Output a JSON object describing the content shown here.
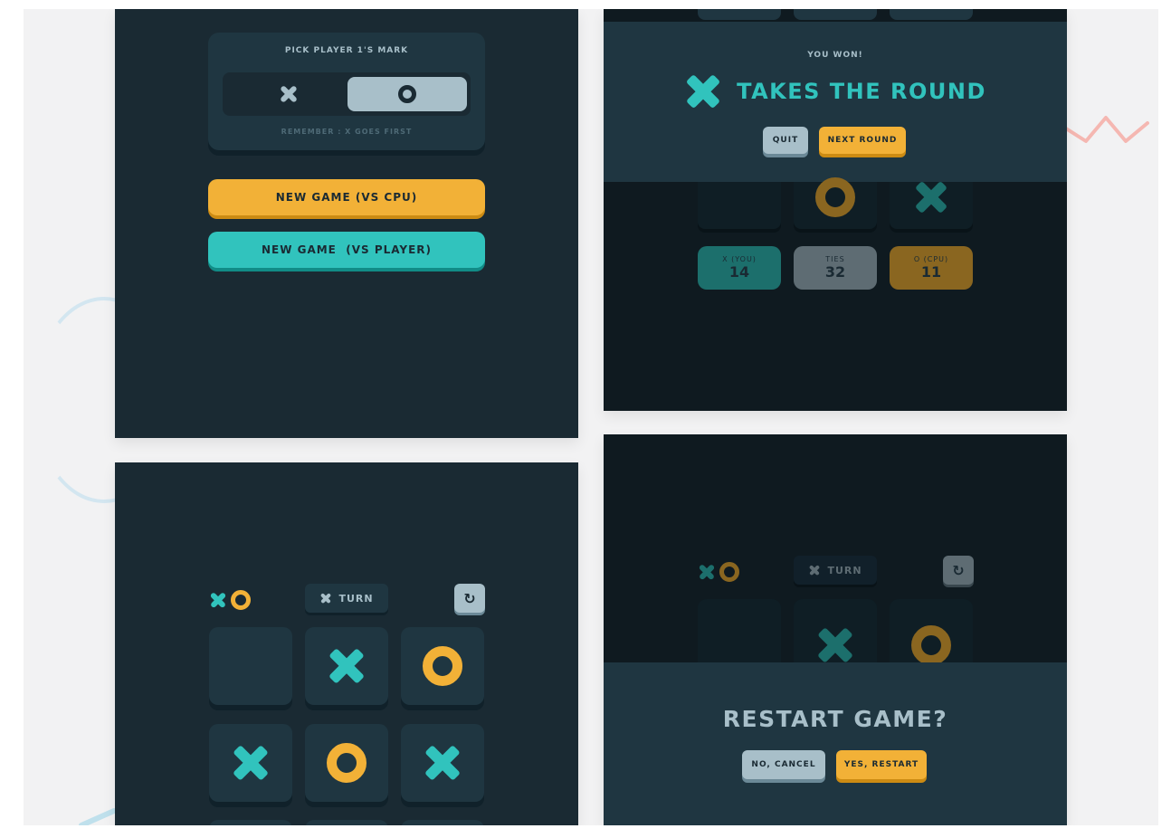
{
  "colors": {
    "teal": "#31c3bd",
    "yellow": "#f2b137",
    "silver": "#a8bfc9",
    "navy": "#1a2a33",
    "semi_navy": "#1f3641"
  },
  "menu": {
    "pick_label": "PICK PLAYER 1'S MARK",
    "selected_mark": "O",
    "remember": "REMEMBER : X GOES FIRST",
    "btn_cpu": "NEW GAME (VS CPU)",
    "btn_player": "NEW GAME  (VS PLAYER)"
  },
  "win_screen": {
    "subtitle": "YOU WON!",
    "headline": "TAKES THE ROUND",
    "winner_mark": "X",
    "quit_label": "QUIT",
    "next_label": "NEXT ROUND",
    "visible_cells": [
      "",
      "O",
      "X"
    ],
    "scores": [
      {
        "title": "X (YOU)",
        "value": "14",
        "color": "#31c3bd"
      },
      {
        "title": "TIES",
        "value": "32",
        "color": "#a8bfc9"
      },
      {
        "title": "O (CPU)",
        "value": "11",
        "color": "#f2b137"
      }
    ]
  },
  "board_screen": {
    "turn_mark": "X",
    "turn_label": "TURN",
    "restart_icon": "restart-icon",
    "cells": [
      "",
      "X",
      "O",
      "X",
      "O",
      "X"
    ]
  },
  "restart_screen": {
    "turn_mark": "X",
    "turn_label": "TURN",
    "visible_cells": [
      "",
      "X",
      "O"
    ],
    "title": "RESTART GAME?",
    "cancel_label": "NO, CANCEL",
    "confirm_label": "YES, RESTART"
  }
}
